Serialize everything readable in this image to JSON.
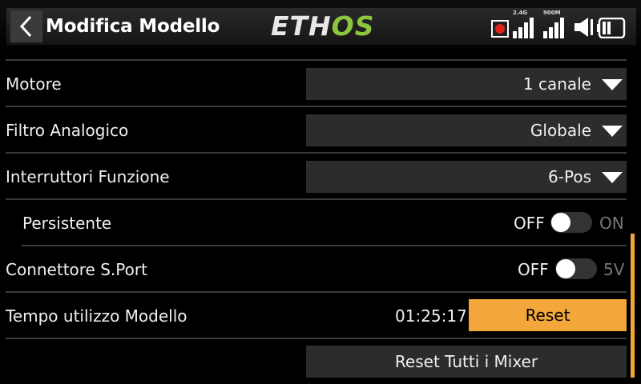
{
  "header": {
    "title": "Modifica Modello",
    "logo_main": "ETH",
    "logo_accent": "OS",
    "signal1_label": "2.4G",
    "signal2_label": "900M",
    "accent_color": "#8cc63f"
  },
  "rows": {
    "motor": {
      "label": "Motore",
      "value": "1 canale"
    },
    "analog_filter": {
      "label": "Filtro Analogico",
      "value": "Globale"
    },
    "function_switches": {
      "label": "Interruttori Funzione",
      "value": "6-Pos"
    },
    "persistent": {
      "label": "Persistente",
      "off_label": "OFF",
      "on_label": "ON"
    },
    "sport_connector": {
      "label": "Connettore S.Port",
      "off_label": "OFF",
      "on_label": "5V"
    },
    "model_time": {
      "label": "Tempo utilizzo Modello",
      "value": "01:25:17",
      "button": "Reset"
    },
    "reset_all": {
      "button": "Reset Tutti i Mixer"
    }
  },
  "colors": {
    "button_accent": "#f3a73b",
    "row_bg": "#2c2c2c"
  }
}
